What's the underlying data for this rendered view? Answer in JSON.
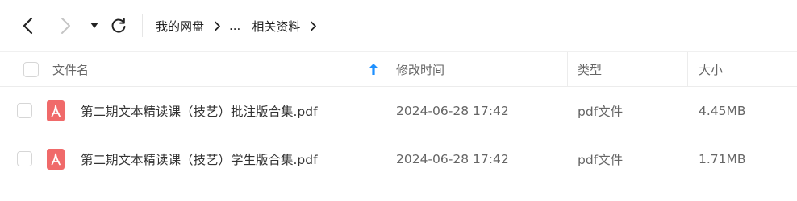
{
  "toolbar": {
    "back_icon": "chevron-left-icon",
    "forward_icon": "chevron-right-icon",
    "dropdown_icon": "caret-down-icon",
    "refresh_icon": "refresh-icon"
  },
  "breadcrumb": {
    "items": [
      "我的网盘",
      "...",
      "相关资料"
    ],
    "separator_icon": "chevron-right-icon"
  },
  "columns": {
    "name": "文件名",
    "modified": "修改时间",
    "type": "类型",
    "size": "大小",
    "sort_icon": "sort-ascending-arrow-icon"
  },
  "files": [
    {
      "name": "第二期文本精读课（技艺）批注版合集.pdf",
      "modified": "2024-06-28 17:42",
      "type": "pdf文件",
      "size": "4.45MB",
      "icon": "pdf-file-icon"
    },
    {
      "name": "第二期文本精读课（技艺）学生版合集.pdf",
      "modified": "2024-06-28 17:42",
      "type": "pdf文件",
      "size": "1.71MB",
      "icon": "pdf-file-icon"
    }
  ],
  "colors": {
    "accent": "#1e90ff",
    "pdf_icon": "#f06a6a"
  }
}
